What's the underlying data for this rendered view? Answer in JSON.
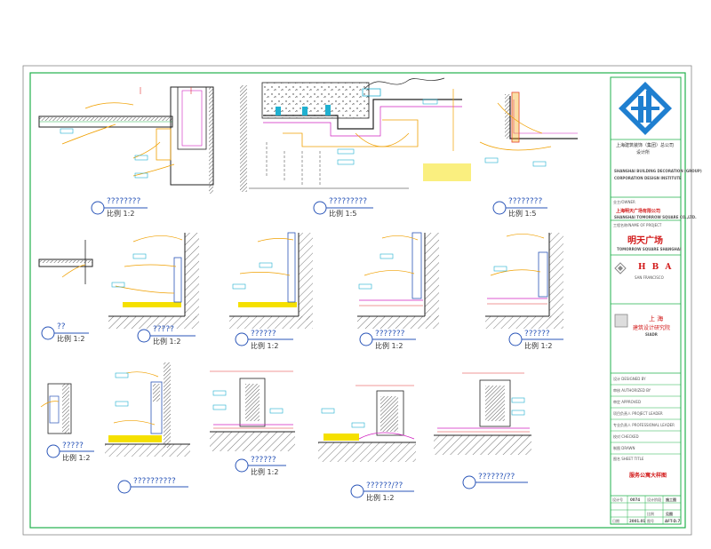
{
  "title_block": {
    "company_line1": "上海建筑装饰（集团）总公司",
    "company_line2": "设计所",
    "company_en1": "SHANGHAI BUILDING DECORATION (GROUP)",
    "company_en2": "CORPORATION DESIGN INSTITUTE",
    "client_label": "业主/OWNER",
    "client_name": "上海明天广场有限公司",
    "client_en": "SHANGHAI TOMORROW SQUARE CO.,LTD.",
    "project_label": "工程名称/NAME OF PROJECT",
    "project_name": "明天广场",
    "project_en": "TOMORROW SQUARE SHANGHAI",
    "hba_name": "H B A",
    "hba_city": "SAN FRANCISCO",
    "institute_city": "上 海",
    "institute_name": "建筑设计研究院",
    "institute_en": "SIADR",
    "rows": [
      "设计 DESIGNED BY",
      "审核 AUTHORIZED BY",
      "审定 APPROVED",
      "项目负责人 PROJECT LEADER",
      "专业负责人 PROFESSIONAL LEADER",
      "校对 CHECKED",
      "制图 DRAWN"
    ],
    "sheet_title_label": "图名 SHEET TITLE",
    "sheet_title": "服务公寓大样图",
    "footer": {
      "c1": "设计号",
      "c1v": "0074",
      "c2": "设计阶段",
      "c2v": "施工图",
      "c3": "比例",
      "c3v": "见图",
      "c4": "日期",
      "c4v": "2001.01",
      "c5": "图号",
      "c5v": "AFT-D.7"
    }
  },
  "details": [
    {
      "title": "????????",
      "scale": "比例 1:2"
    },
    {
      "title": "?????????",
      "scale": "比例 1:5"
    },
    {
      "title": "????????",
      "scale": "比例 1:5"
    },
    {
      "title": "??",
      "scale": "比例 1:2"
    },
    {
      "title": "?????",
      "scale": "比例 1:2"
    },
    {
      "title": "??????",
      "scale": "比例 1:2"
    },
    {
      "title": "???????",
      "scale": "比例 1:2"
    },
    {
      "title": "??????",
      "scale": "比例 1:2"
    },
    {
      "title": "?????",
      "scale": "比例 1:2"
    },
    {
      "title": "??????????",
      "scale": ""
    },
    {
      "title": "??????",
      "scale": "比例 1:2"
    },
    {
      "title": "??????/??",
      "scale": "比例 1:2"
    },
    {
      "title": "??????/??",
      "scale": ""
    }
  ],
  "colors": {
    "frame_green": "#22b14c",
    "wall": "#222222",
    "annotation": "#f0a000",
    "dim_red": "#e03030",
    "magenta": "#d020c0",
    "cyan": "#20b0d0",
    "yellow_fill": "#f5e000",
    "title_blue": "#2a55b8",
    "logo_blue": "#1f7fd0"
  }
}
